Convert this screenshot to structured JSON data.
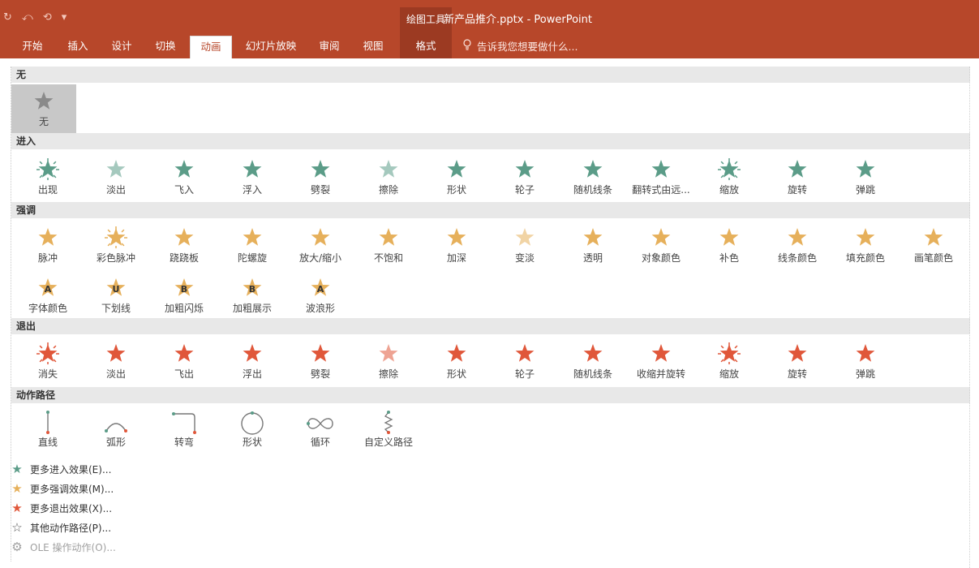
{
  "qat": [
    "↻",
    "⤺",
    "⟲",
    "▾"
  ],
  "context_group": "绘图工具",
  "doc_title": "新产品推介.pptx - PowerPoint",
  "tabs": [
    {
      "label": "开始"
    },
    {
      "label": "插入"
    },
    {
      "label": "设计"
    },
    {
      "label": "切换"
    },
    {
      "label": "动画"
    },
    {
      "label": "幻灯片放映"
    },
    {
      "label": "审阅"
    },
    {
      "label": "视图"
    },
    {
      "label": "格式"
    }
  ],
  "tell_me": "告诉我您想要做什么...",
  "colors": {
    "brand": "#b7472a",
    "enter": "#5b9c88",
    "emphasis": "#e6b05b",
    "exit": "#e0573a",
    "path": "#555555"
  },
  "sections": {
    "none": {
      "title": "无",
      "items": [
        {
          "label": "无",
          "icon": "none-star-icon"
        }
      ]
    },
    "entrance": {
      "title": "进入",
      "items": [
        {
          "label": "出现"
        },
        {
          "label": "淡出"
        },
        {
          "label": "飞入"
        },
        {
          "label": "浮入"
        },
        {
          "label": "劈裂"
        },
        {
          "label": "擦除"
        },
        {
          "label": "形状"
        },
        {
          "label": "轮子"
        },
        {
          "label": "随机线条"
        },
        {
          "label": "翻转式由远..."
        },
        {
          "label": "缩放"
        },
        {
          "label": "旋转"
        },
        {
          "label": "弹跳"
        }
      ]
    },
    "emphasis": {
      "title": "强调",
      "items": [
        {
          "label": "脉冲"
        },
        {
          "label": "彩色脉冲"
        },
        {
          "label": "跷跷板"
        },
        {
          "label": "陀螺旋"
        },
        {
          "label": "放大/缩小"
        },
        {
          "label": "不饱和"
        },
        {
          "label": "加深"
        },
        {
          "label": "变淡"
        },
        {
          "label": "透明"
        },
        {
          "label": "对象颜色"
        },
        {
          "label": "补色"
        },
        {
          "label": "线条颜色"
        },
        {
          "label": "填充颜色"
        },
        {
          "label": "画笔颜色"
        },
        {
          "label": "字体颜色",
          "glyph": "A"
        },
        {
          "label": "下划线",
          "glyph": "U"
        },
        {
          "label": "加粗闪烁",
          "glyph": "B"
        },
        {
          "label": "加粗展示",
          "glyph": "B"
        },
        {
          "label": "波浪形",
          "glyph": "A"
        }
      ]
    },
    "exit": {
      "title": "退出",
      "items": [
        {
          "label": "消失"
        },
        {
          "label": "淡出"
        },
        {
          "label": "飞出"
        },
        {
          "label": "浮出"
        },
        {
          "label": "劈裂"
        },
        {
          "label": "擦除"
        },
        {
          "label": "形状"
        },
        {
          "label": "轮子"
        },
        {
          "label": "随机线条"
        },
        {
          "label": "收缩并旋转"
        },
        {
          "label": "缩放"
        },
        {
          "label": "旋转"
        },
        {
          "label": "弹跳"
        }
      ]
    },
    "paths": {
      "title": "动作路径",
      "items": [
        {
          "label": "直线"
        },
        {
          "label": "弧形"
        },
        {
          "label": "转弯"
        },
        {
          "label": "形状"
        },
        {
          "label": "循环"
        },
        {
          "label": "自定义路径"
        }
      ]
    }
  },
  "more": [
    {
      "label": "更多进入效果(E)...",
      "icon": "★",
      "color": "#5b9c88"
    },
    {
      "label": "更多强调效果(M)...",
      "icon": "★",
      "color": "#e6b05b"
    },
    {
      "label": "更多退出效果(X)...",
      "icon": "★",
      "color": "#e0573a"
    },
    {
      "label": "其他动作路径(P)...",
      "icon": "☆",
      "color": "#555555"
    },
    {
      "label": "OLE 操作动作(O)...",
      "icon": "⚙",
      "color": "#a0a0a0",
      "disabled": true
    }
  ]
}
